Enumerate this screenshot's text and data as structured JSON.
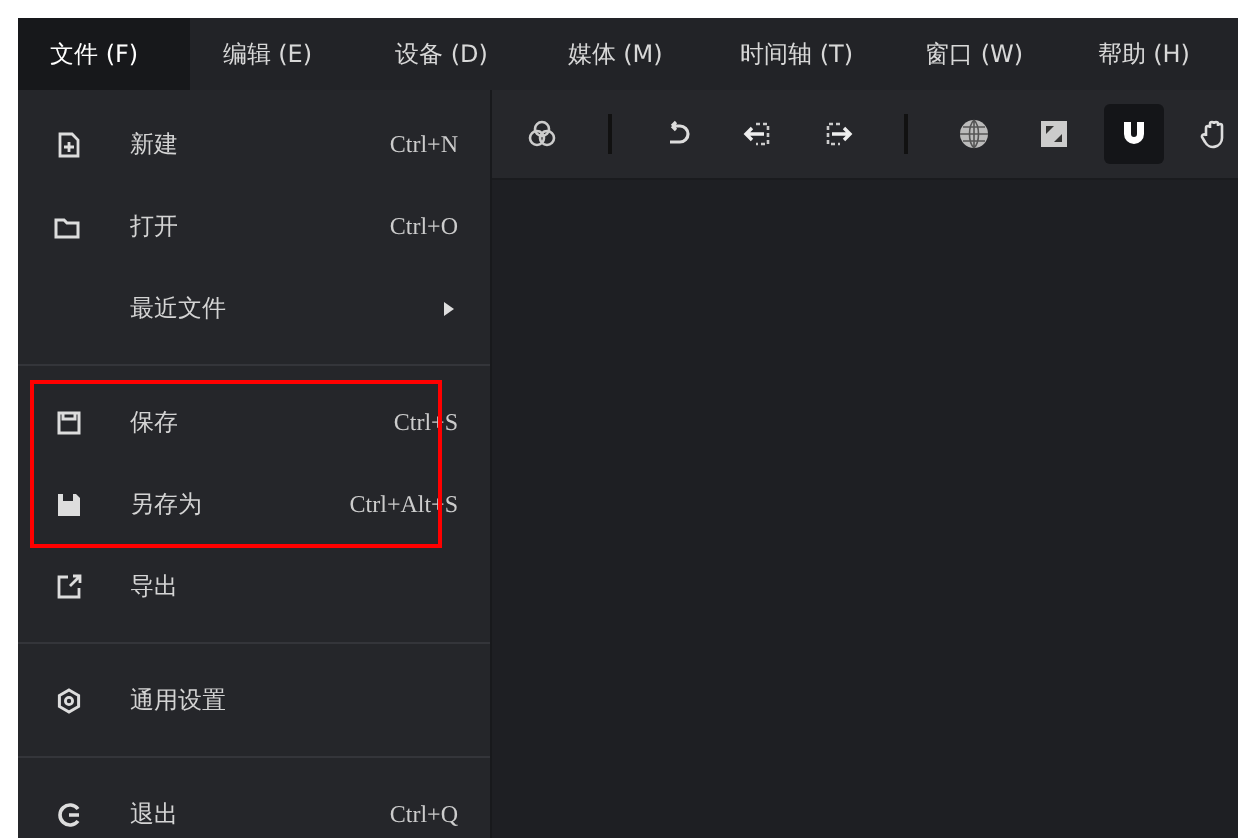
{
  "menubar": [
    {
      "label": "文件 (F)",
      "selected": true
    },
    {
      "label": "编辑 (E)",
      "selected": false
    },
    {
      "label": "设备 (D)",
      "selected": false
    },
    {
      "label": "媒体 (M)",
      "selected": false
    },
    {
      "label": "时间轴 (T)",
      "selected": false
    },
    {
      "label": "窗口 (W)",
      "selected": false
    },
    {
      "label": "帮助 (H)",
      "selected": false
    }
  ],
  "file_menu": {
    "groups": [
      [
        {
          "label": "新建",
          "shortcut": "Ctrl+N",
          "has_submenu": false,
          "highlighted": false
        },
        {
          "label": "打开",
          "shortcut": "Ctrl+O",
          "has_submenu": false,
          "highlighted": false
        },
        {
          "label": "最近文件",
          "has_submenu": true,
          "highlighted": false
        }
      ],
      [
        {
          "label": "保存",
          "shortcut": "Ctrl+S",
          "has_submenu": false,
          "highlighted": true
        },
        {
          "label": "另存为",
          "shortcut": "Ctrl+Alt+S",
          "has_submenu": false,
          "highlighted": true
        },
        {
          "label": "导出",
          "has_submenu": false,
          "highlighted": false
        }
      ],
      [
        {
          "label": "通用设置",
          "has_submenu": false,
          "highlighted": false
        }
      ],
      [
        {
          "label": "退出",
          "shortcut": "Ctrl+Q",
          "has_submenu": false,
          "highlighted": false
        }
      ]
    ]
  },
  "toolbar": {
    "groups": [
      [
        {
          "selected": false
        }
      ],
      [
        {
          "selected": false
        },
        {
          "selected": false
        },
        {
          "selected": false
        }
      ],
      [
        {
          "selected": false
        },
        {
          "selected": false
        },
        {
          "selected": true
        },
        {
          "selected": false
        }
      ]
    ]
  }
}
